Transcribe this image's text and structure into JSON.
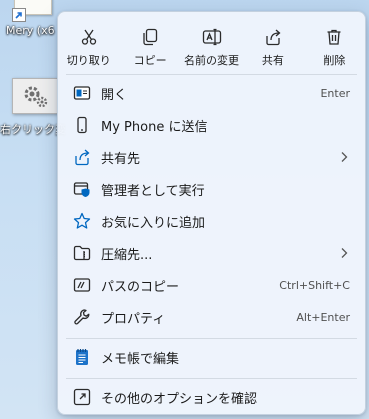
{
  "desktop": {
    "icon1_label": "Mery (x6",
    "icon2_label": "右クリック変"
  },
  "quick_actions": [
    {
      "label": "切り取り",
      "icon": "scissors-icon"
    },
    {
      "label": "コピー",
      "icon": "copy-icon"
    },
    {
      "label": "名前の変更",
      "icon": "rename-icon"
    },
    {
      "label": "共有",
      "icon": "share-icon"
    },
    {
      "label": "削除",
      "icon": "trash-icon"
    }
  ],
  "items": [
    {
      "label": "開く",
      "shortcut": "Enter",
      "icon": "open-icon"
    },
    {
      "label": "My Phone に送信",
      "icon": "phone-icon"
    },
    {
      "label": "共有先",
      "icon": "share-to-icon",
      "submenu": true
    },
    {
      "label": "管理者として実行",
      "icon": "admin-shield-icon"
    },
    {
      "label": "お気に入りに追加",
      "icon": "star-icon"
    },
    {
      "label": "圧縮先...",
      "icon": "zip-folder-icon",
      "submenu": true
    },
    {
      "label": "パスのコピー",
      "shortcut": "Ctrl+Shift+C",
      "icon": "copy-path-icon"
    },
    {
      "label": "プロパティ",
      "shortcut": "Alt+Enter",
      "icon": "wrench-icon"
    },
    {
      "label": "メモ帳で編集",
      "icon": "notepad-icon"
    },
    {
      "label": "その他のオプションを確認",
      "icon": "more-options-icon"
    }
  ],
  "colors": {
    "accent": "#0067c0",
    "menu_bg": "#eef4fc",
    "text": "#1b1b1b"
  }
}
